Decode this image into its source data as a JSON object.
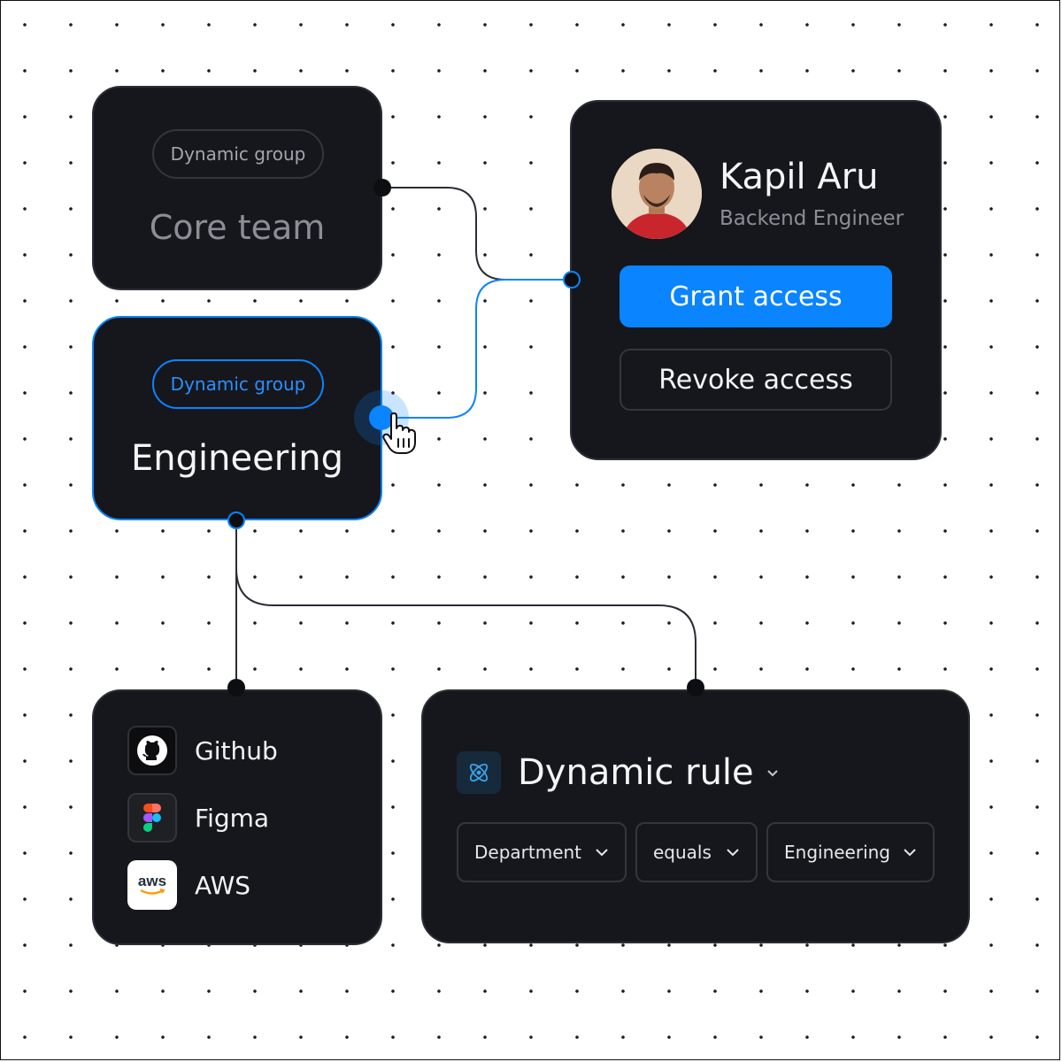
{
  "groups": [
    {
      "tag": "Dynamic group",
      "title": "Core team"
    },
    {
      "tag": "Dynamic group",
      "title": "Engineering"
    }
  ],
  "user": {
    "name": "Kapil Aru",
    "role": "Backend Engineer",
    "grant_label": "Grant access",
    "revoke_label": "Revoke access"
  },
  "apps": [
    {
      "name": "Github",
      "icon": "github-icon"
    },
    {
      "name": "Figma",
      "icon": "figma-icon"
    },
    {
      "name": "AWS",
      "icon": "aws-icon",
      "logo_text": "aws"
    }
  ],
  "rule": {
    "title": "Dynamic rule",
    "icon": "atom-icon",
    "conditions": [
      "Department",
      "equals",
      "Engineering"
    ]
  },
  "colors": {
    "accent": "#0a84ff",
    "card": "#16171c",
    "card_border": "#2c2e36",
    "muted_text": "#8b8e96"
  }
}
